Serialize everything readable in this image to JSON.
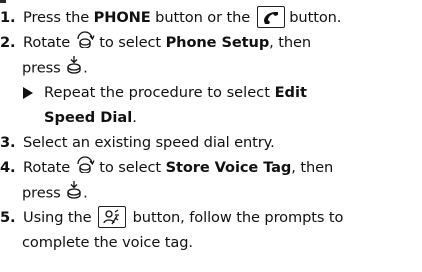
{
  "steps": [
    {
      "number": "1.",
      "lines": [
        {
          "t1": "Press the ",
          "b1": "PHONE",
          "t2": " button or the ",
          "t3": " button."
        }
      ]
    },
    {
      "number": "2.",
      "line1": {
        "t1": "Rotate ",
        "t2": " to select ",
        "b1": "Phone Setup",
        "t3": ", then"
      },
      "line2": {
        "t1": "press ",
        "t2": "."
      },
      "sub": {
        "t1": "Repeat the procedure to select ",
        "b1": "Edit",
        "b2": "Speed Dial",
        "t2": "."
      }
    },
    {
      "number": "3.",
      "text": "Select an existing speed dial entry."
    },
    {
      "number": "4.",
      "line1": {
        "t1": "Rotate ",
        "t2": " to select ",
        "b1": "Store Voice Tag",
        "t3": ", then"
      },
      "line2": {
        "t1": "press ",
        "t2": "."
      }
    },
    {
      "number": "5.",
      "line1": {
        "t1": "Using the ",
        "t2": " button, follow the prompts to"
      },
      "line2": {
        "t1": "complete the voice tag."
      }
    }
  ],
  "icons": {
    "phone_button": "phone-button-icon",
    "selector_knob": "selector-knob-icon",
    "press_knob": "press-knob-icon",
    "talk_button": "talk-button-icon",
    "arrow": "triangle-arrow-icon"
  }
}
